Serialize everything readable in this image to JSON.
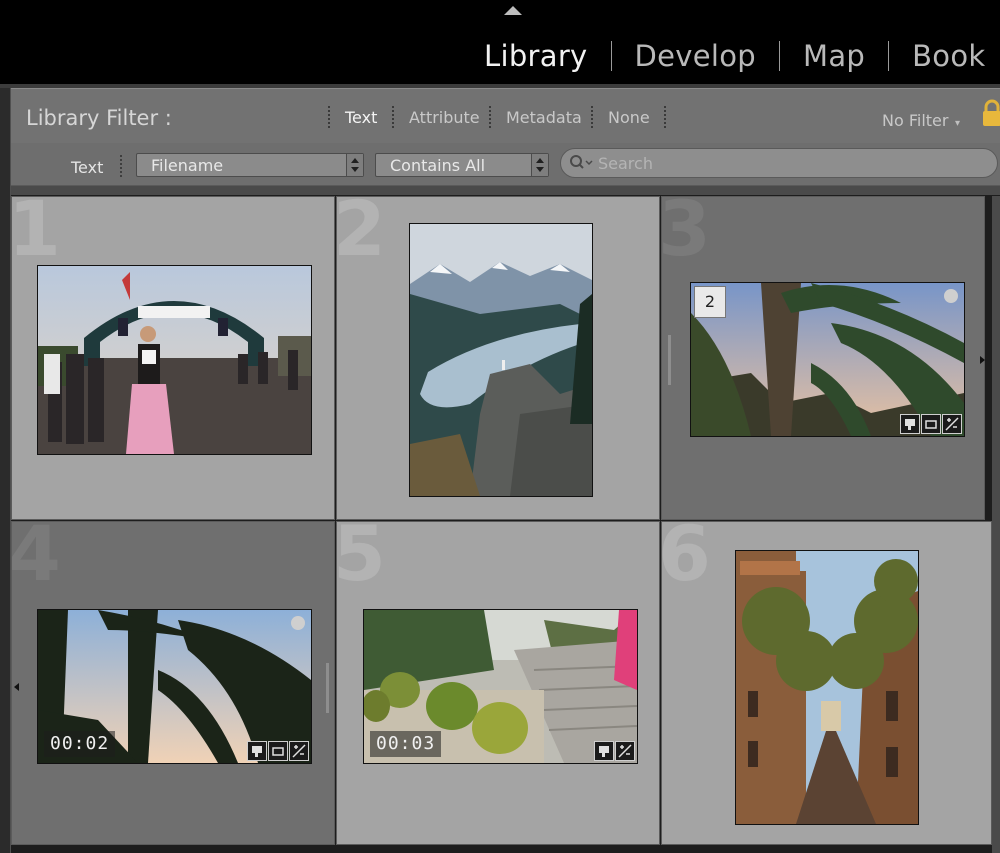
{
  "modules": [
    {
      "label": "Library",
      "active": true
    },
    {
      "label": "Develop",
      "active": false
    },
    {
      "label": "Map",
      "active": false
    },
    {
      "label": "Book",
      "active": false
    }
  ],
  "filter": {
    "title": "Library Filter :",
    "tabs": [
      {
        "label": "Text",
        "active": true
      },
      {
        "label": "Attribute",
        "active": false
      },
      {
        "label": "Metadata",
        "active": false
      },
      {
        "label": "None",
        "active": false
      }
    ],
    "preset": "No Filter"
  },
  "text_filter": {
    "label": "Text",
    "field": "Filename",
    "rule": "Contains All",
    "search_placeholder": "Search"
  },
  "grid": {
    "cells": [
      {
        "index": "1",
        "scene": "Oktoberfest entrance"
      },
      {
        "index": "2",
        "scene": "Mountain lake overlook"
      },
      {
        "index": "3",
        "scene": "Palm trees at dusk",
        "selected": true,
        "stack_count": "2"
      },
      {
        "index": "4",
        "scene": "Palm silhouettes video",
        "duration": "00:02"
      },
      {
        "index": "5",
        "scene": "Cactus garden video",
        "duration": "00:03"
      },
      {
        "index": "6",
        "scene": "Narrow tree-lined street"
      }
    ]
  },
  "colors": {
    "accent": "#f2f2f2",
    "panel": "#727272",
    "cell_light": "#a4a4a4",
    "cell_dark": "#6f6f6f"
  }
}
